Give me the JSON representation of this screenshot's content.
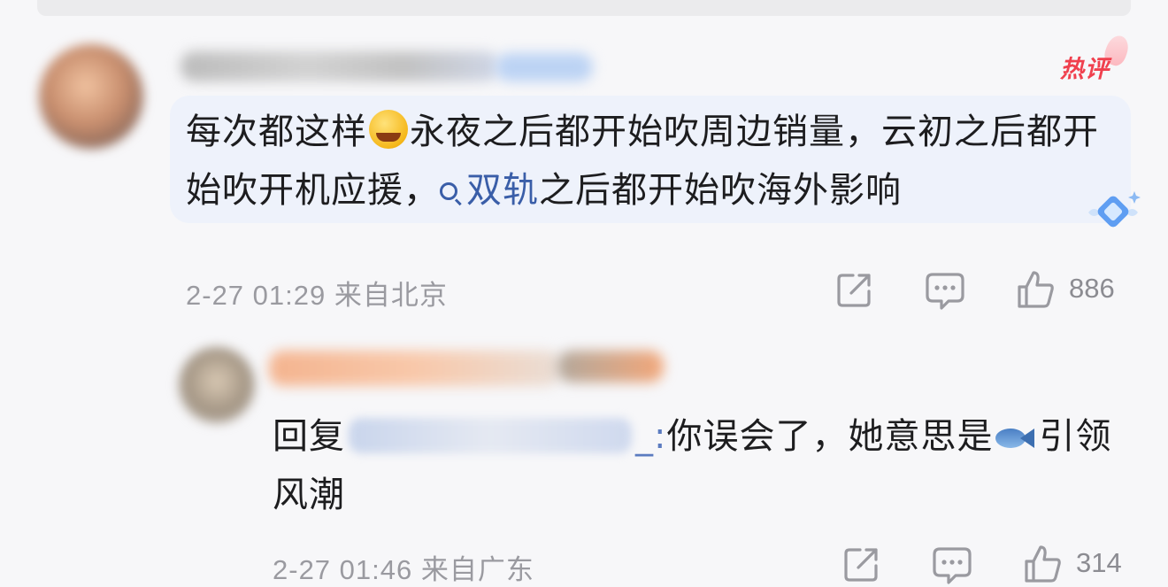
{
  "hot_badge": "热评",
  "main_comment": {
    "text_1": "每次都这样",
    "text_2": "永夜之后都开始吹周边销量，云初之后都开始吹开机应援，",
    "search_link": "双轨",
    "text_3": "之后都开始吹海外影响",
    "date": "2-27 01:29",
    "location": "来自北京",
    "like_count": "886"
  },
  "reply_comment": {
    "prefix": "回复",
    "mention_tail": "_:",
    "text_1": "你误会了，她意思是",
    "text_2": "引领风潮",
    "date": "2-27 01:46",
    "location": "来自广东",
    "like_count": "314"
  },
  "icons": [
    "share-icon",
    "comment-icon",
    "like-icon",
    "search-icon",
    "laughing-emoji-icon",
    "fish-emoji-icon",
    "diamond-badge-icon"
  ],
  "colors": {
    "accent_blue": "#3a5ea8",
    "hot_red": "#f0404e",
    "meta_gray": "#9a9aa0"
  }
}
